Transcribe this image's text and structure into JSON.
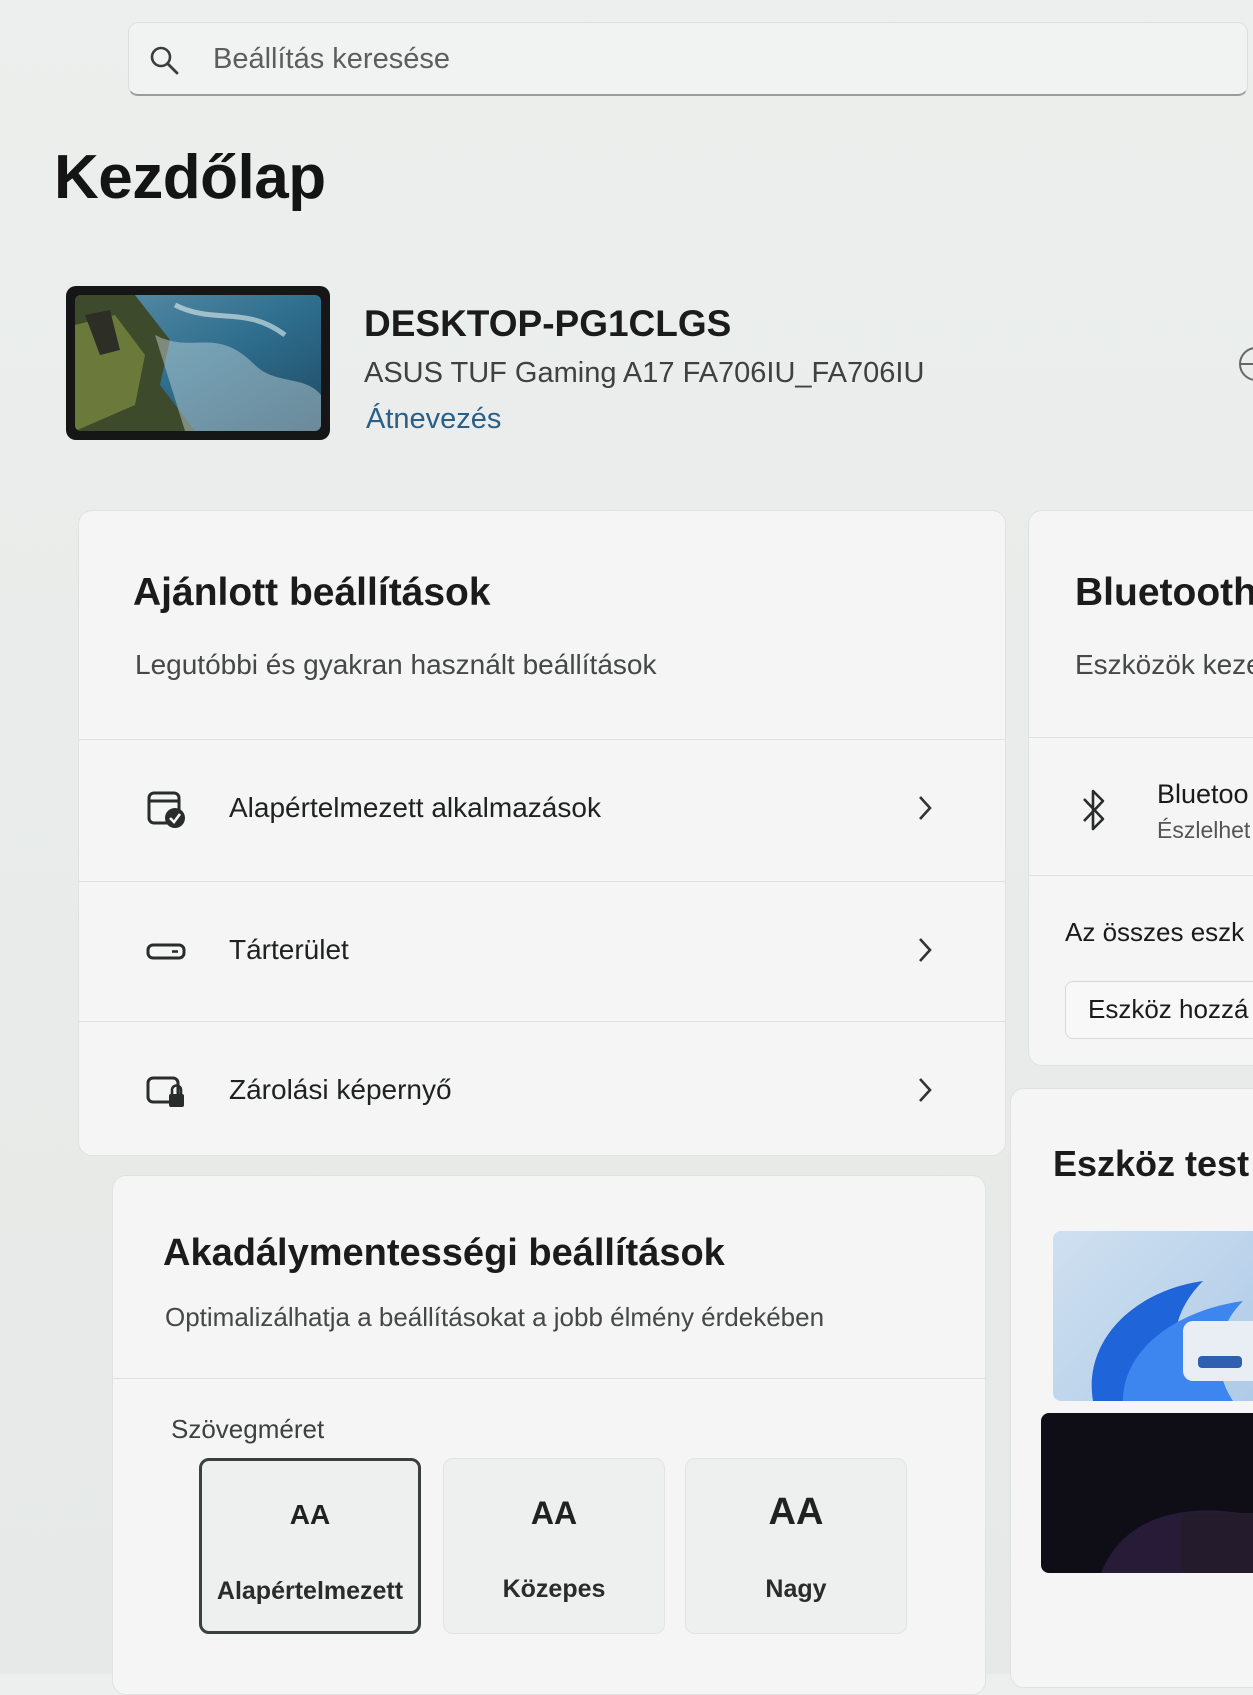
{
  "search": {
    "placeholder": "Beállítás keresése",
    "icon": "search-icon"
  },
  "page": {
    "title": "Kezdőlap"
  },
  "device": {
    "name": "DESKTOP-PG1CLGS",
    "model": "ASUS TUF Gaming A17 FA706IU_FA706IU",
    "rename_label": "Átnevezés"
  },
  "recommended": {
    "title": "Ajánlott beállítások",
    "subtitle": "Legutóbbi és gyakran használt beállítások",
    "items": [
      {
        "label": "Alapértelmezett alkalmazások",
        "icon": "default-apps-icon"
      },
      {
        "label": "Tárterület",
        "icon": "storage-icon"
      },
      {
        "label": "Zárolási képernyő",
        "icon": "lock-screen-icon"
      }
    ]
  },
  "accessibility": {
    "title": "Akadálymentességi beállítások",
    "subtitle": "Optimalizálhatja a beállításokat a jobb élmény érdekében",
    "text_size_label": "Szövegméret",
    "glyph": "AA",
    "options": [
      {
        "label": "Alapértelmezett",
        "selected": true
      },
      {
        "label": "Közepes",
        "selected": false
      },
      {
        "label": "Nagy",
        "selected": false
      }
    ]
  },
  "bluetooth": {
    "title": "Bluetooth",
    "subtitle": "Eszközök keze",
    "item_title": "Bluetoo",
    "item_sub": "Észlelhet",
    "all_devices": "Az összes eszk",
    "add_device": "Eszköz hozzá"
  },
  "device_customize": {
    "title": "Eszköz test"
  }
}
